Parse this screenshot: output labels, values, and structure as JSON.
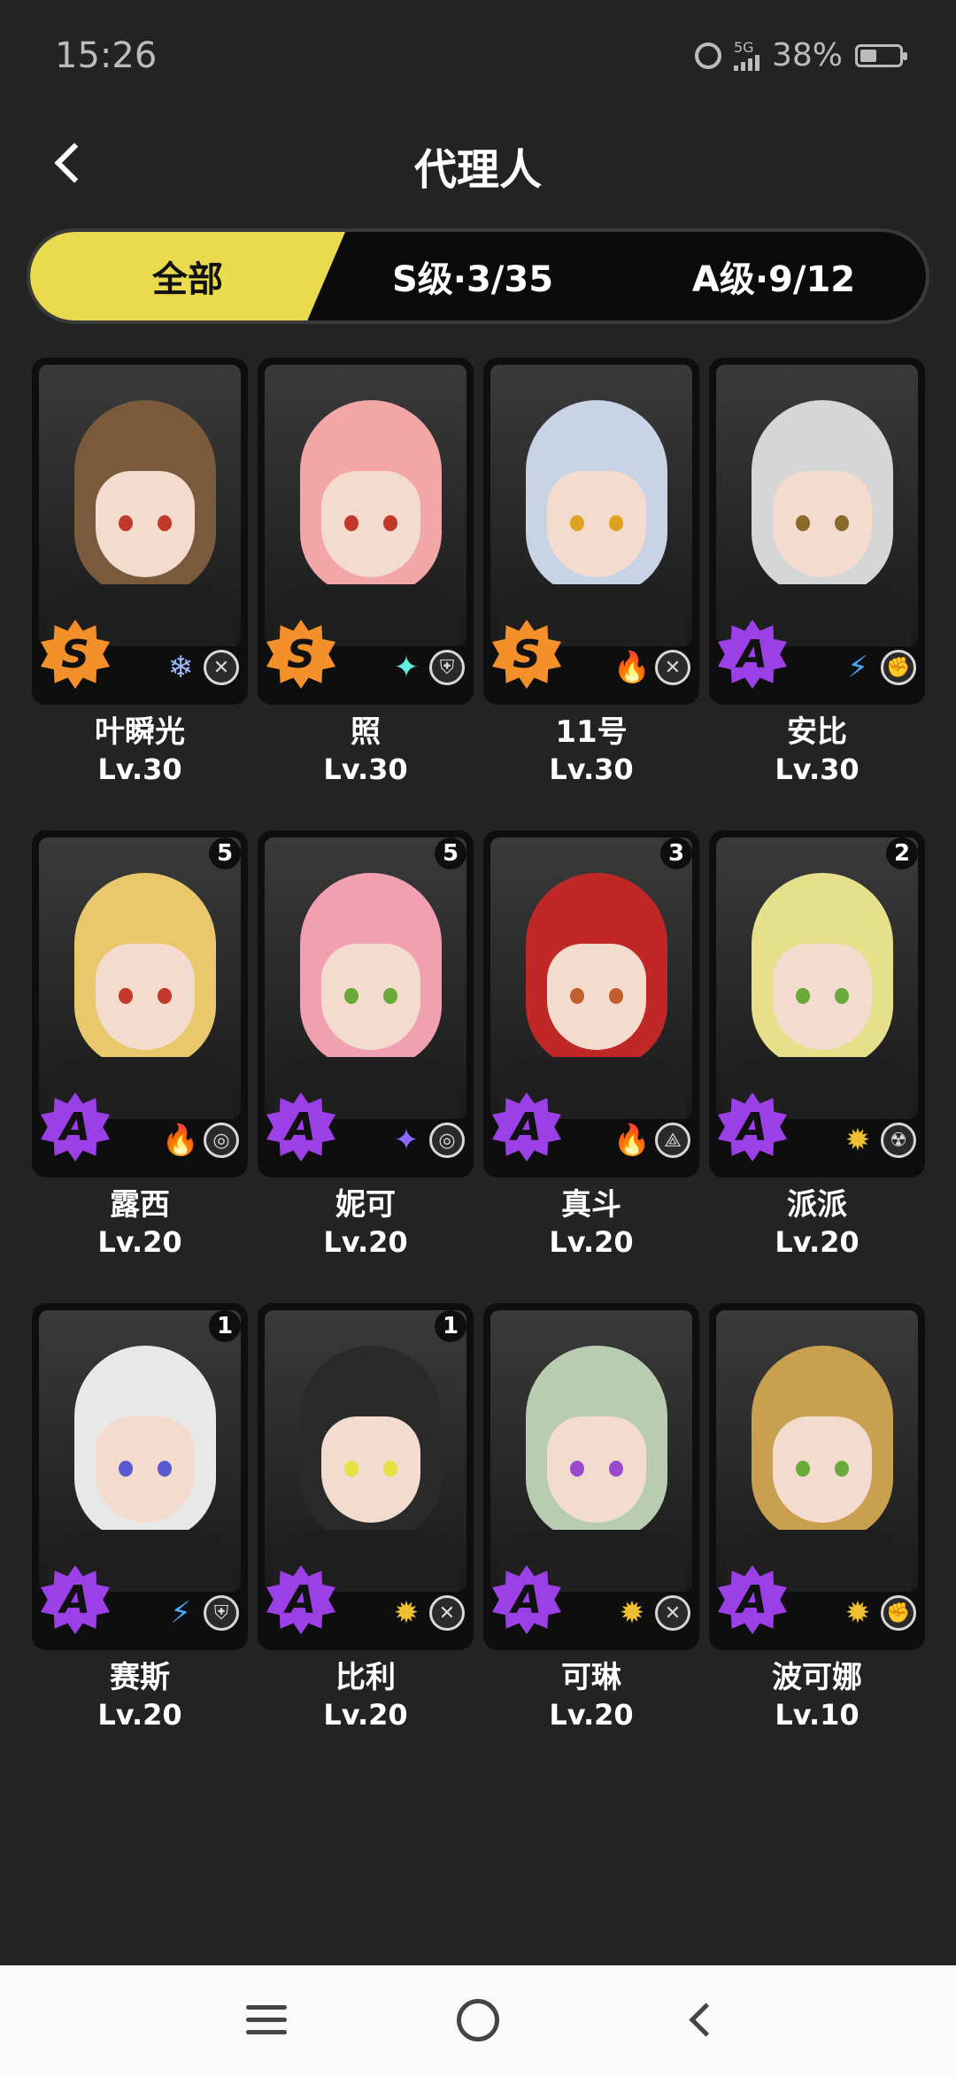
{
  "status_bar": {
    "time": "15:26",
    "network": "5G",
    "battery": "38%"
  },
  "header": {
    "title": "代理人"
  },
  "tabs": [
    {
      "label": "全部",
      "active": true
    },
    {
      "label": "S级·3/35",
      "active": false
    },
    {
      "label": "A级·9/12",
      "active": false
    }
  ],
  "agents": [
    {
      "name": "叶瞬光",
      "level": "Lv.30",
      "rank": "S",
      "element_icon": "ice-crystal-icon",
      "element_color": "#9fb8ff",
      "role_icon": "attack-icon",
      "cinema": "",
      "hair": "#7a5a3c",
      "eye": "#c0392b"
    },
    {
      "name": "照",
      "level": "Lv.30",
      "rank": "S",
      "element_icon": "ether-star-icon",
      "element_color": "#5ff0e0",
      "role_icon": "defense-icon",
      "cinema": "",
      "hair": "#f2a6a6",
      "eye": "#c0392b"
    },
    {
      "name": "11号",
      "level": "Lv.30",
      "rank": "S",
      "element_icon": "fire-icon",
      "element_color": "#ff5a2a",
      "role_icon": "attack-icon",
      "cinema": "",
      "hair": "#c9d3e6",
      "eye": "#e0a020"
    },
    {
      "name": "安比",
      "level": "Lv.30",
      "rank": "A",
      "element_icon": "electric-icon",
      "element_color": "#4aa8ff",
      "role_icon": "stun-icon",
      "cinema": "",
      "hair": "#d6d6d6",
      "eye": "#8a6a2a"
    },
    {
      "name": "露西",
      "level": "Lv.20",
      "rank": "A",
      "element_icon": "fire-icon",
      "element_color": "#ff5a2a",
      "role_icon": "support-icon",
      "cinema": "5",
      "hair": "#e8c86a",
      "eye": "#c0392b"
    },
    {
      "name": "妮可",
      "level": "Lv.20",
      "rank": "A",
      "element_icon": "ether-star-icon",
      "element_color": "#8a6aff",
      "role_icon": "support-icon",
      "cinema": "5",
      "hair": "#f0a0b0",
      "eye": "#6aa83a"
    },
    {
      "name": "真斗",
      "level": "Lv.20",
      "rank": "A",
      "element_icon": "fire-icon",
      "element_color": "#ff5a2a",
      "role_icon": "rupture-icon",
      "cinema": "3",
      "hair": "#c02828",
      "eye": "#c06030"
    },
    {
      "name": "派派",
      "level": "Lv.20",
      "rank": "A",
      "element_icon": "physical-icon",
      "element_color": "#f0c030",
      "role_icon": "anomaly-icon",
      "cinema": "2",
      "hair": "#e6e08a",
      "eye": "#6aa83a"
    },
    {
      "name": "赛斯",
      "level": "Lv.20",
      "rank": "A",
      "element_icon": "electric-icon",
      "element_color": "#4aa8ff",
      "role_icon": "defense-icon",
      "cinema": "1",
      "hair": "#e8e8e8",
      "eye": "#5a5ad0"
    },
    {
      "name": "比利",
      "level": "Lv.20",
      "rank": "A",
      "element_icon": "physical-icon",
      "element_color": "#f0c030",
      "role_icon": "attack-icon",
      "cinema": "1",
      "hair": "#2a2a2a",
      "eye": "#e6e040"
    },
    {
      "name": "可琳",
      "level": "Lv.20",
      "rank": "A",
      "element_icon": "physical-icon",
      "element_color": "#f0c030",
      "role_icon": "attack-icon",
      "cinema": "",
      "hair": "#b8cdb0",
      "eye": "#9a4ad0"
    },
    {
      "name": "波可娜",
      "level": "Lv.10",
      "rank": "A",
      "element_icon": "physical-icon",
      "element_color": "#f0c030",
      "role_icon": "stun-icon",
      "cinema": "",
      "hair": "#c8a050",
      "eye": "#6aa83a"
    }
  ],
  "nav": {
    "menu": "menu-icon",
    "home": "home-icon",
    "back": "back-icon"
  }
}
